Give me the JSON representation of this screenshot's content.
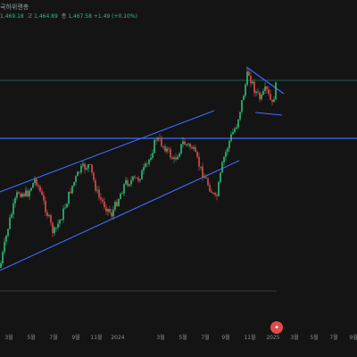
{
  "header": {
    "title_fragment": "국하위랜총",
    "ohlc": {
      "open": "1,469.18",
      "high_label": "고",
      "high": "1,464.89",
      "low_label": "저",
      "low": "",
      "close_label": "종",
      "close": "1,467.58",
      "change": "+1.49 (+0.10%)"
    }
  },
  "colors": {
    "background": "#141414",
    "up_candle": "#2fbf7a",
    "down_candle": "#e14b4b",
    "trendline": "#3d6bff",
    "price_line": "#2b7a66"
  },
  "x_axis_labels": [
    "3월",
    "5월",
    "7월",
    "9월",
    "11월",
    "2024",
    "3월",
    "5월",
    "7월",
    "9월",
    "11월",
    "2025",
    "3월",
    "5월",
    "7월",
    "9월",
    "11월"
  ],
  "event_badge": {
    "icon": "event-icon"
  },
  "chart_data": {
    "type": "candlestick",
    "title": "",
    "x_labels": [
      "3월",
      "5월",
      "7월",
      "9월",
      "11월",
      "2024",
      "3월",
      "5월",
      "7월",
      "9월",
      "11월",
      "2025",
      "3월",
      "5월",
      "7월",
      "9월",
      "11월"
    ],
    "ylim": [
      0,
      100
    ],
    "series": [
      {
        "period": "3월",
        "value": 20
      },
      {
        "period": "5월",
        "value": 28
      },
      {
        "period": "7월",
        "value": 22
      },
      {
        "period": "9월",
        "value": 35
      },
      {
        "period": "11월",
        "value": 27
      },
      {
        "period": "2024",
        "value": 38
      },
      {
        "period": "3월",
        "value": 44
      },
      {
        "period": "5월",
        "value": 42
      },
      {
        "period": "7월",
        "value": 40
      },
      {
        "period": "9월",
        "value": 30
      },
      {
        "period": "11월",
        "value": 67
      },
      {
        "period": "2025",
        "value": 62
      },
      {
        "period": "3월",
        "value": 65
      }
    ],
    "trendlines": [
      {
        "name": "upper-channel",
        "from": [
          0,
          27
        ],
        "to": [
          10.8,
          62
        ]
      },
      {
        "name": "lower-channel",
        "from": [
          0,
          3
        ],
        "to": [
          11.8,
          47
        ]
      },
      {
        "name": "support-horizontal",
        "from": [
          0,
          50
        ],
        "to": [
          16,
          50
        ]
      },
      {
        "name": "wedge-upper",
        "from": [
          12,
          70
        ],
        "to": [
          13.7,
          60
        ]
      },
      {
        "name": "wedge-lower",
        "from": [
          12.2,
          56
        ],
        "to": [
          13.7,
          55
        ]
      }
    ],
    "grid": false,
    "legend": "none"
  }
}
